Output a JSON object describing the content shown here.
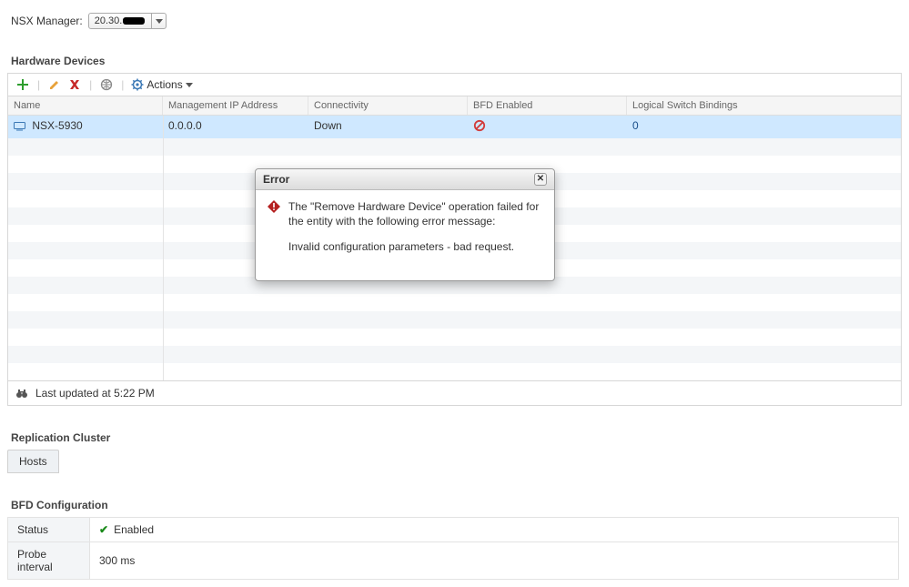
{
  "header": {
    "label": "NSX Manager:",
    "selected_prefix": "20.30."
  },
  "hardware_devices": {
    "title": "Hardware Devices",
    "actions_label": "Actions",
    "columns": {
      "name": "Name",
      "ip": "Management IP Address",
      "conn": "Connectivity",
      "bfd": "BFD Enabled",
      "lsb": "Logical Switch Bindings"
    },
    "rows": [
      {
        "name": "NSX-5930",
        "ip": "0.0.0.0",
        "conn": "Down",
        "bfd_enabled": false,
        "lsb": "0"
      }
    ],
    "status_text": "Last updated at 5:22 PM"
  },
  "error_dialog": {
    "title": "Error",
    "line1": "The \"Remove Hardware Device\" operation failed for the entity with the following error message:",
    "line2": "Invalid configuration parameters - bad request."
  },
  "replication_cluster": {
    "title": "Replication Cluster",
    "tab_label": "Hosts"
  },
  "bfd_config": {
    "title": "BFD Configuration",
    "status_key": "Status",
    "status_value": "Enabled",
    "probe_key": "Probe interval",
    "probe_value": "300 ms"
  }
}
